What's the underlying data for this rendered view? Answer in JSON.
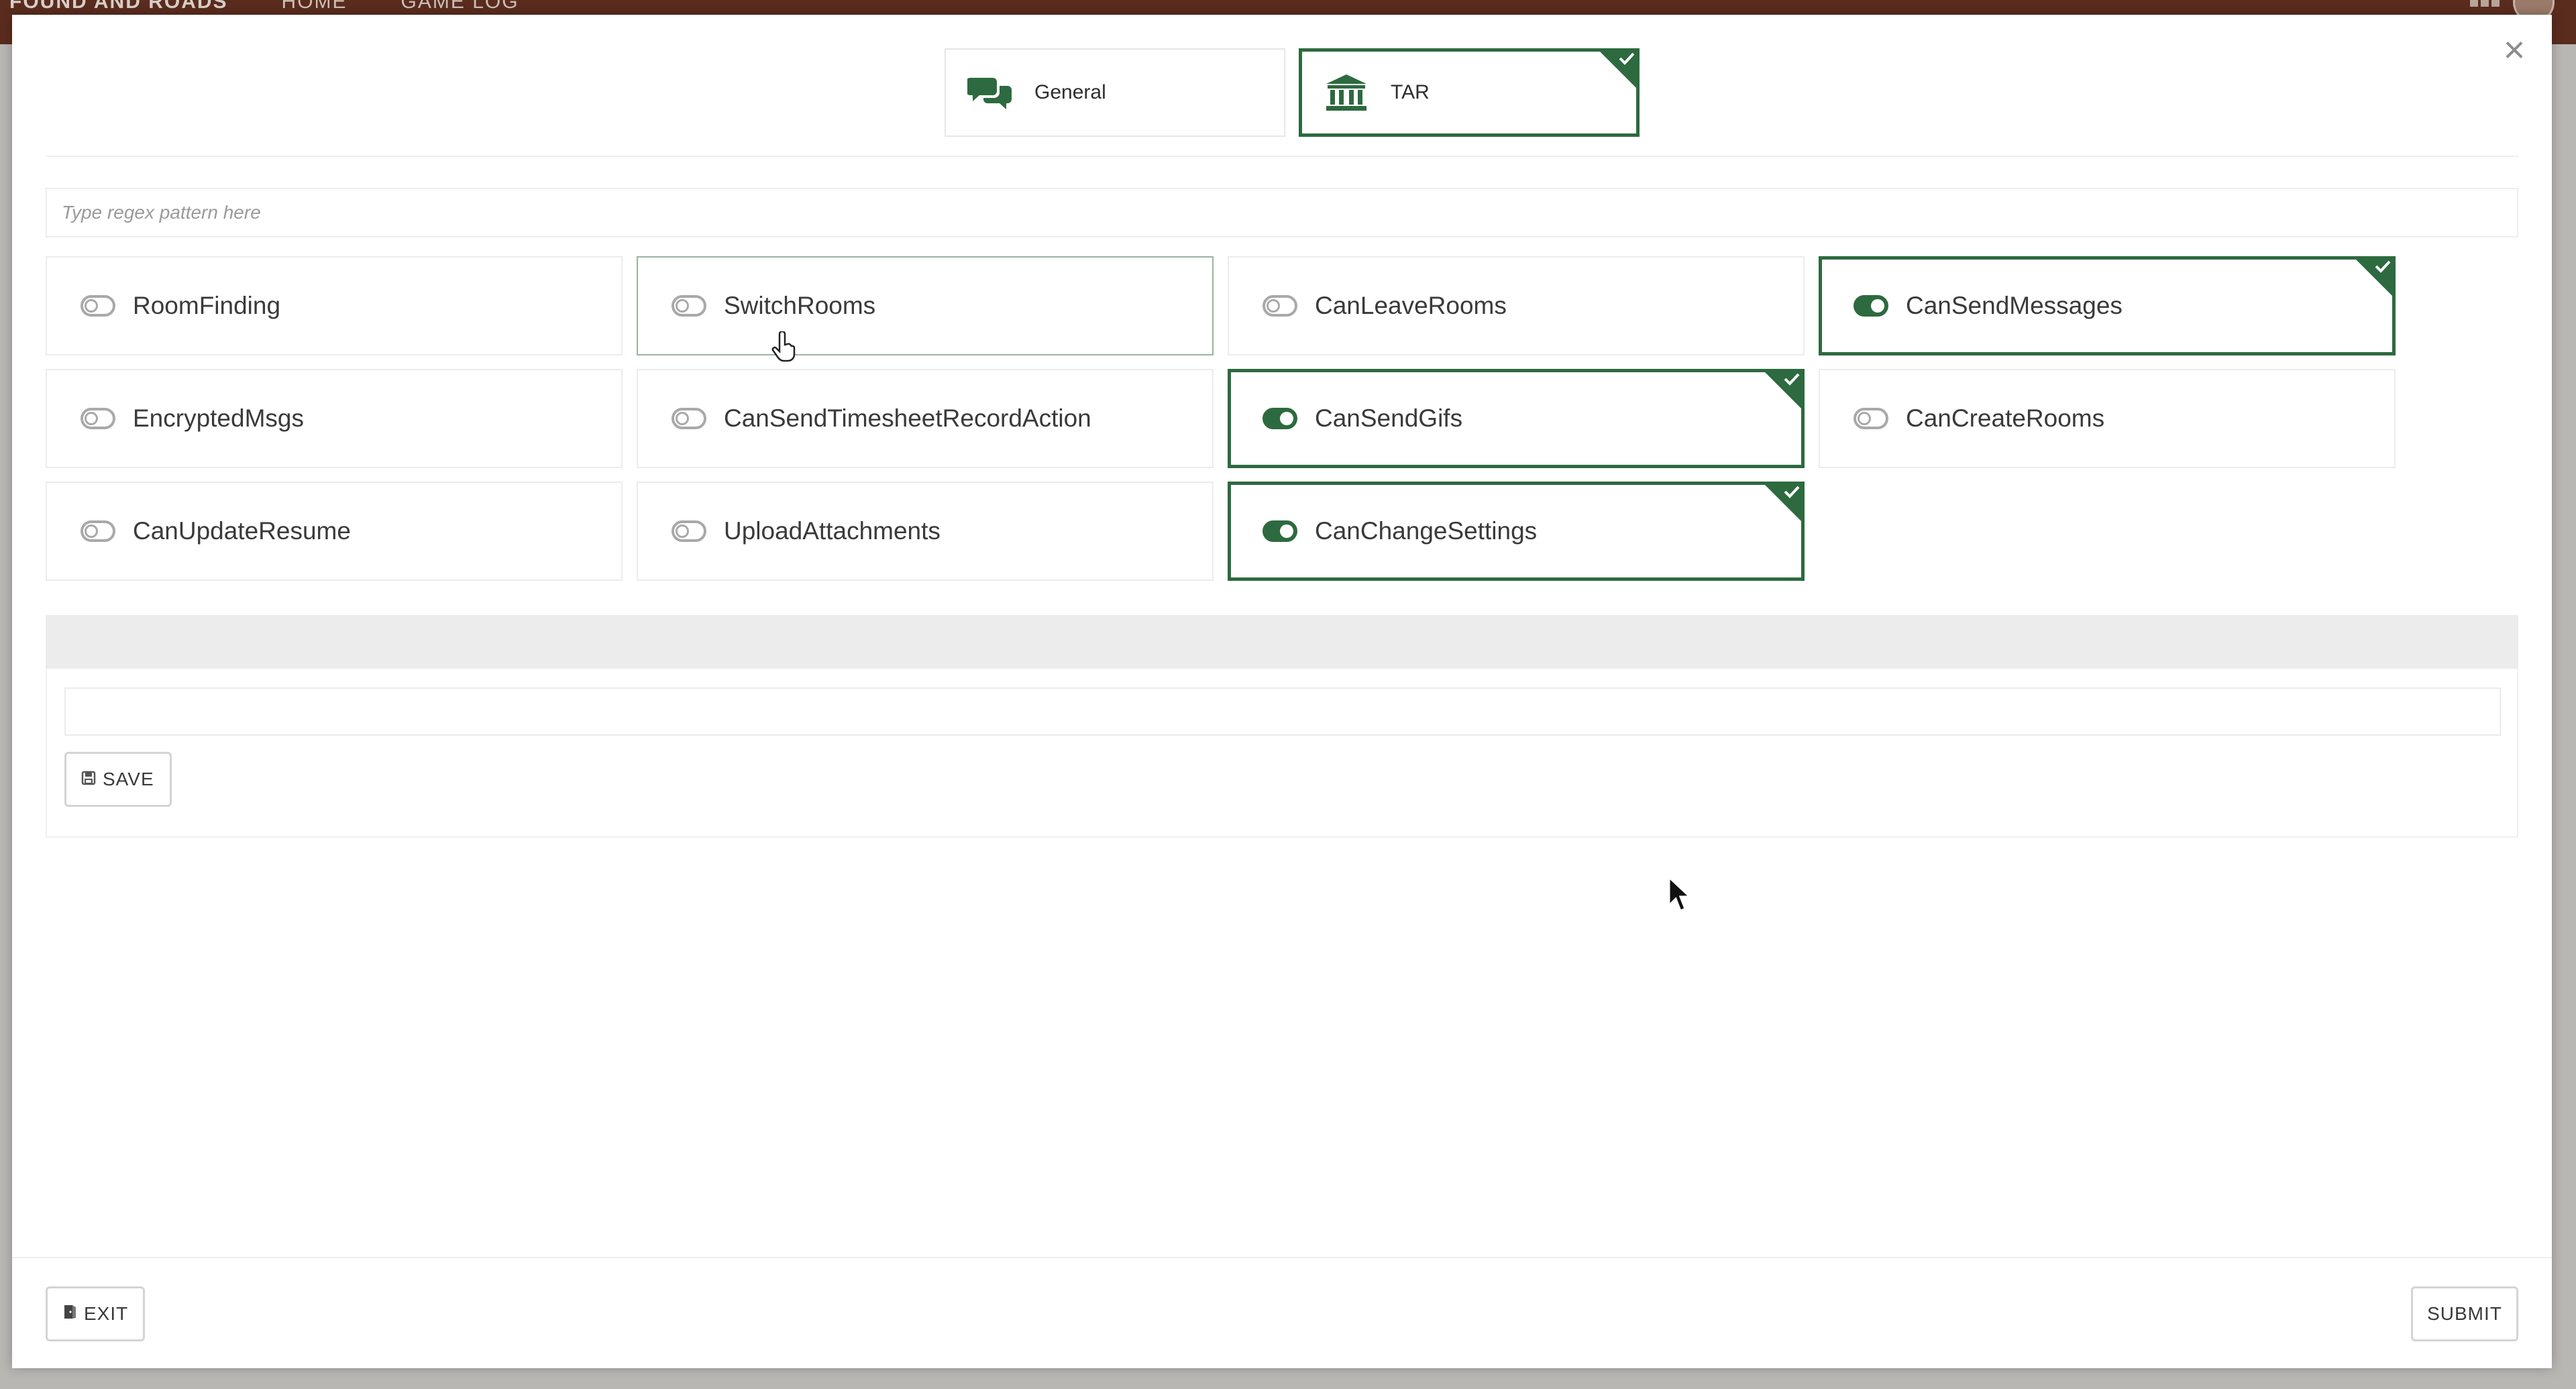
{
  "app_bar": {
    "brand": "FOUND AND ROADS",
    "nav": [
      "HOME",
      "GAME LOG"
    ]
  },
  "modal": {
    "close_glyph": "×",
    "tabs": [
      {
        "label": "General",
        "icon": "chat-bubbles-icon",
        "active": false
      },
      {
        "label": "TAR",
        "icon": "bank-building-icon",
        "active": true
      }
    ],
    "regex_placeholder": "Type regex pattern here",
    "permissions": [
      {
        "label": "RoomFinding",
        "enabled": false
      },
      {
        "label": "SwitchRooms",
        "enabled": false
      },
      {
        "label": "CanLeaveRooms",
        "enabled": false
      },
      {
        "label": "CanSendMessages",
        "enabled": true
      },
      {
        "label": "EncryptedMsgs",
        "enabled": false
      },
      {
        "label": "CanSendTimesheetRecordAction",
        "enabled": false
      },
      {
        "label": "CanSendGifs",
        "enabled": true
      },
      {
        "label": "CanCreateRooms",
        "enabled": false
      },
      {
        "label": "CanUpdateResume",
        "enabled": false
      },
      {
        "label": "UploadAttachments",
        "enabled": false
      },
      {
        "label": "CanChangeSettings",
        "enabled": true
      }
    ],
    "save_label": "SAVE",
    "exit_label": "EXIT",
    "submit_label": "SUBMIT"
  },
  "colors": {
    "accent": "#2d6a3f",
    "app_bar": "#5a2c1e"
  }
}
